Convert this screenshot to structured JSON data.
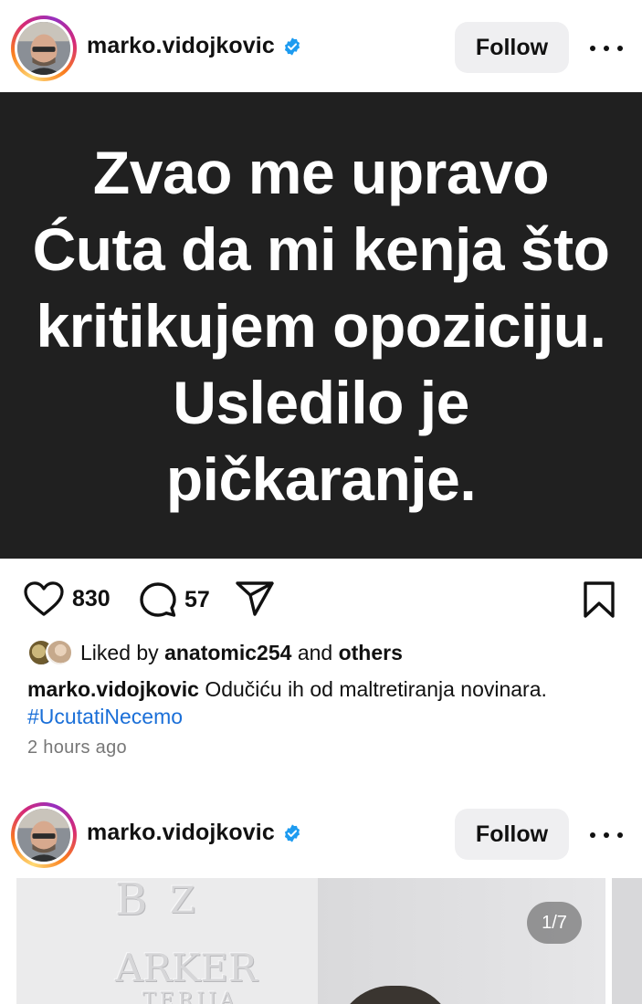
{
  "posts": [
    {
      "username": "marko.vidojkovic",
      "follow_label": "Follow",
      "image_text": "Zvao me upravo Ćuta da mi kenja što kritikujem opoziciju. Usledilo je pičkaranje.",
      "likes": "830",
      "comments": "57",
      "liked_by_prefix": "Liked by",
      "liked_by_user": "anatomic254",
      "liked_by_and": "and",
      "liked_by_others": "others",
      "caption_user": "marko.vidojkovic",
      "caption_text": "Odučiću ih od maltretiranja novinara.",
      "hashtag": "#UcutatiNecemo",
      "time": "2 hours ago"
    },
    {
      "username": "marko.vidojkovic",
      "follow_label": "Follow",
      "image_counter": "1/7",
      "image_wall_text": [
        "B",
        "Z",
        "ARKER",
        "TERIJA"
      ]
    }
  ],
  "colors": {
    "hashtag": "#1a6fd8",
    "verified": "#1d9bf0",
    "follow_bg": "#efeff1",
    "post_bg": "#202020"
  },
  "icons": [
    "more-icon",
    "verified-badge-icon",
    "heart-icon",
    "comment-icon",
    "share-icon",
    "bookmark-icon"
  ]
}
